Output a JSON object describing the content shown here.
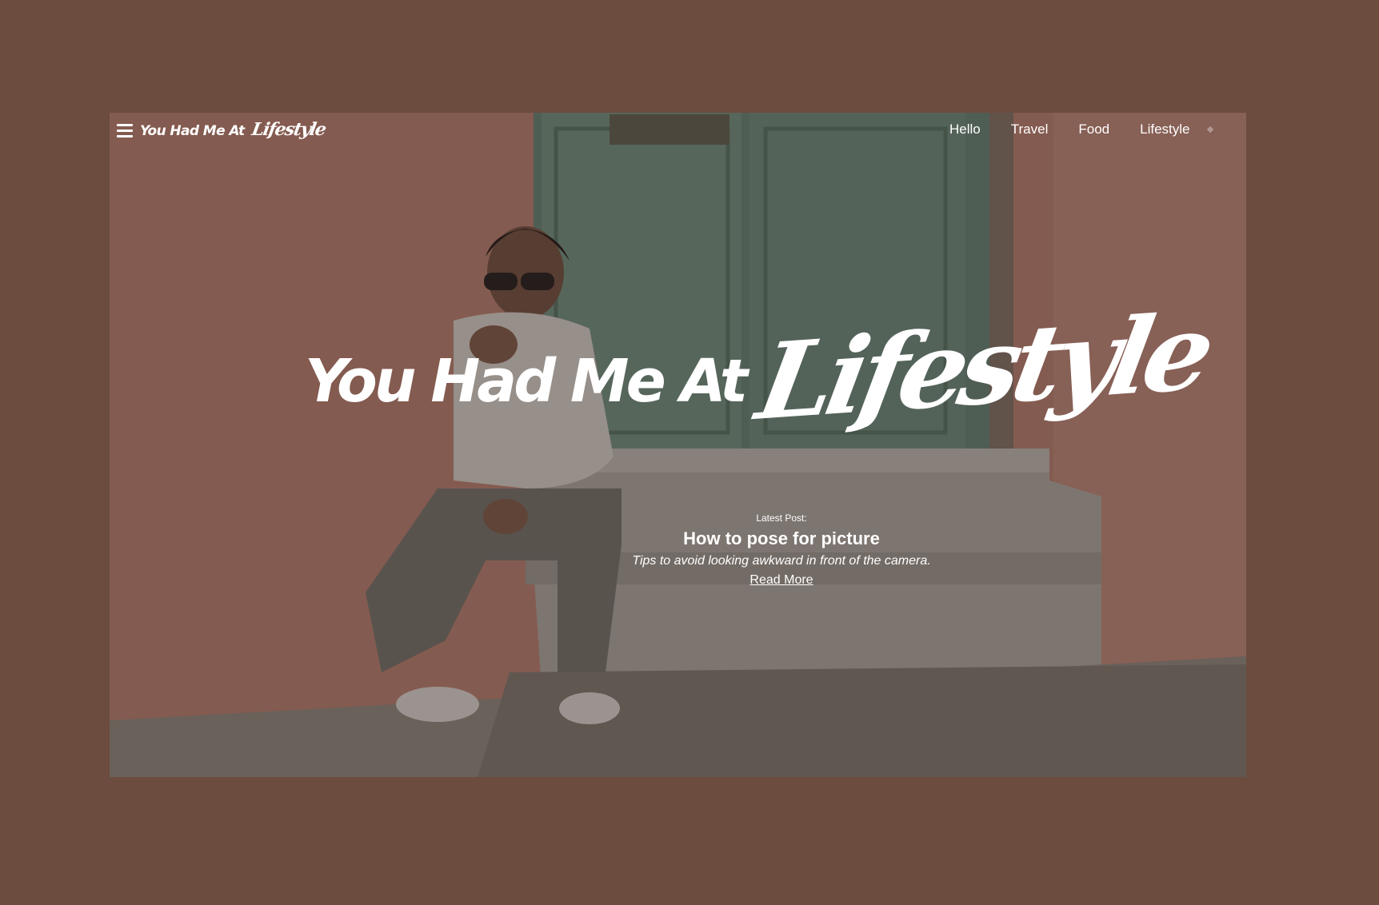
{
  "nav": {
    "brand": {
      "prefix": "You Had Me At",
      "accent": "Lifestyle"
    },
    "links": [
      "Hello",
      "Travel",
      "Food",
      "Lifestyle"
    ]
  },
  "hero": {
    "title": {
      "prefix": "You Had Me At",
      "accent": "Lifestyle"
    },
    "latest": {
      "label": "Latest Post:",
      "title": "How to pose for picture",
      "description": "Tips to avoid looking awkward in front of the camera.",
      "cta": "Read More"
    }
  },
  "colors": {
    "page_background": "#6b4c3e",
    "door": "#6d8c7c",
    "wall": "#c88a78",
    "text": "#ffffff"
  },
  "icons": [
    "hamburger-menu-icon"
  ]
}
